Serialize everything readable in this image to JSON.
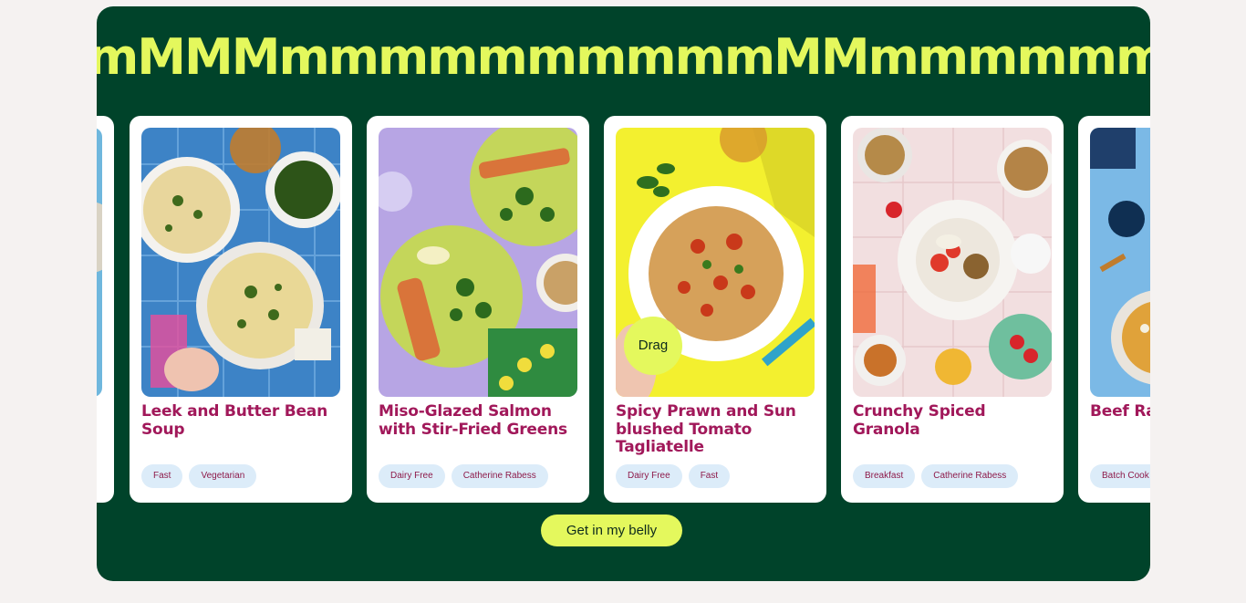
{
  "marquee": {
    "text": "mMMMmmmmmmmmmmMMmmmmmmmmmMMmmmmmmm"
  },
  "cards": [
    {
      "title": "Leek and Butter Bean Soup",
      "tags": [
        "Fast",
        "Vegetarian"
      ]
    },
    {
      "title": "Miso-Glazed Salmon with Stir-Fried Greens",
      "tags": [
        "Dairy Free",
        "Catherine Rabess"
      ]
    },
    {
      "title": "Spicy Prawn and Sun blushed Tomato Tagliatelle",
      "tags": [
        "Dairy Free",
        "Fast"
      ]
    },
    {
      "title": "Crunchy Spiced Granola",
      "tags": [
        "Breakfast",
        "Catherine Rabess"
      ]
    },
    {
      "title": "Beef Ra… Paperd…",
      "tags": [
        "Batch Cook"
      ]
    }
  ],
  "drag_label": "Drag",
  "cta_label": "Get in my belly",
  "colors": {
    "panel": "#00432a",
    "accent": "#e4f85d",
    "title": "#a1185a",
    "tag_bg": "#dcecf9",
    "page_bg": "#f5f2f1"
  }
}
